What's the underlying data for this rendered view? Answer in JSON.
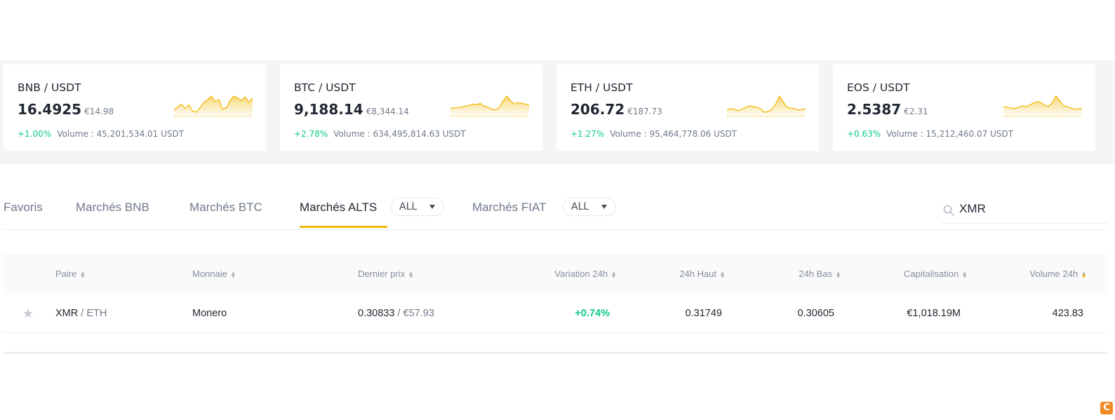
{
  "tickers": [
    {
      "pair": "BNB / USDT",
      "price": "16.4925",
      "fiat": "€14.98",
      "change": "+1.00%",
      "volume": "Volume : 45,201,534.01 USDT",
      "spark": [
        6,
        10,
        13,
        8,
        12,
        5,
        4,
        9,
        15,
        18,
        22,
        16,
        18,
        7,
        9,
        17,
        22,
        20,
        17,
        21,
        15,
        20
      ]
    },
    {
      "pair": "BTC / USDT",
      "price": "9,188.14",
      "fiat": "€8,344.14",
      "change": "+2.78%",
      "volume": "Volume : 634,495,814.63 USDT",
      "spark": [
        10,
        11,
        11,
        12,
        13,
        14,
        16,
        15,
        17,
        13,
        12,
        9,
        8,
        11,
        20,
        27,
        21,
        16,
        18,
        17,
        16,
        15
      ]
    },
    {
      "pair": "ETH / USDT",
      "price": "206.72",
      "fiat": "€187.73",
      "change": "+1.27%",
      "volume": "Volume : 95,464,778.06 USDT",
      "spark": [
        8,
        10,
        9,
        7,
        9,
        12,
        14,
        13,
        12,
        10,
        5,
        6,
        9,
        16,
        28,
        20,
        12,
        11,
        10,
        8,
        9,
        10
      ]
    },
    {
      "pair": "EOS / USDT",
      "price": "2.5387",
      "fiat": "€2.31",
      "change": "+0.63%",
      "volume": "Volume : 15,212,460.07 USDT",
      "spark": [
        13,
        12,
        11,
        10,
        12,
        14,
        13,
        15,
        18,
        20,
        19,
        15,
        13,
        18,
        28,
        22,
        14,
        13,
        11,
        9,
        10,
        10
      ]
    }
  ],
  "spark_color": "#f0b90b",
  "tabs": {
    "favoris": "Favoris",
    "bnb": "Marchés BNB",
    "btc": "Marchés BTC",
    "alts": "Marchés ALTS",
    "alts_filter": "ALL",
    "fiat": "Marchés FIAT",
    "fiat_filter": "ALL"
  },
  "search": {
    "value": "XMR"
  },
  "table": {
    "headers": {
      "paire": "Paire",
      "monnaie": "Monnaie",
      "dernier_prix": "Dernier prix",
      "variation": "Variation 24h",
      "haut": "24h Haut",
      "bas": "24h Bas",
      "cap": "Capitalisation",
      "volume": "Volume 24h"
    },
    "rows": [
      {
        "base": "XMR",
        "quote": "/ ETH",
        "monnaie": "Monero",
        "price": "0.30833",
        "price_fiat": "/ €57.93",
        "variation": "+0.74%",
        "haut": "0.31749",
        "bas": "0.30605",
        "cap": "€1,018.19M",
        "volume": "423.83"
      }
    ]
  },
  "accent_color": "#f0b90b",
  "positive_color": "#0ecb81"
}
